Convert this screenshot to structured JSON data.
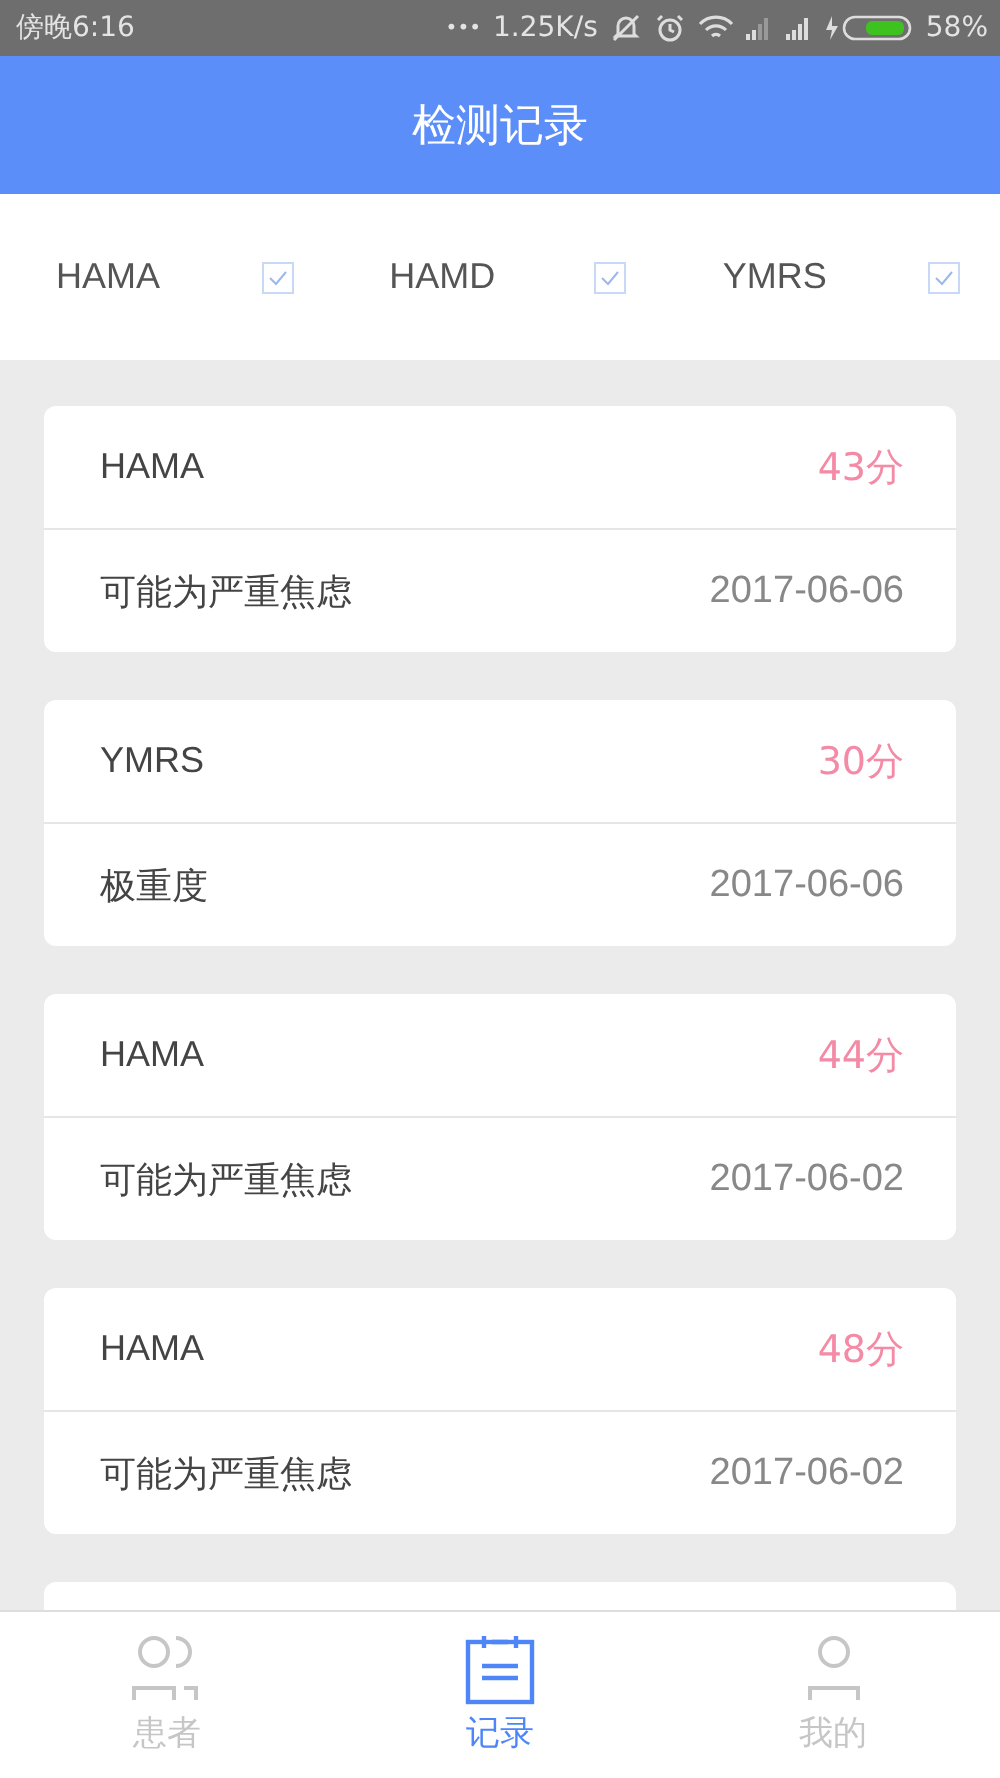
{
  "status_bar": {
    "time": "傍晚6:16",
    "dots": "•••",
    "speed": "1.25K/s",
    "battery": "58%"
  },
  "header": {
    "title": "检测记录"
  },
  "filters": [
    {
      "label": "HAMA",
      "checked": true
    },
    {
      "label": "HAMD",
      "checked": true
    },
    {
      "label": "YMRS",
      "checked": true
    }
  ],
  "records": [
    {
      "scale": "HAMA",
      "score": "43分",
      "result": "可能为严重焦虑",
      "date": "2017-06-06"
    },
    {
      "scale": "YMRS",
      "score": "30分",
      "result": "极重度",
      "date": "2017-06-06"
    },
    {
      "scale": "HAMA",
      "score": "44分",
      "result": "可能为严重焦虑",
      "date": "2017-06-02"
    },
    {
      "scale": "HAMA",
      "score": "48分",
      "result": "可能为严重焦虑",
      "date": "2017-06-02"
    }
  ],
  "tab_bar": [
    {
      "label": "患者",
      "kind": "patients",
      "selected": false
    },
    {
      "label": "记录",
      "kind": "records",
      "selected": true
    },
    {
      "label": "我的",
      "kind": "me",
      "selected": false
    }
  ]
}
